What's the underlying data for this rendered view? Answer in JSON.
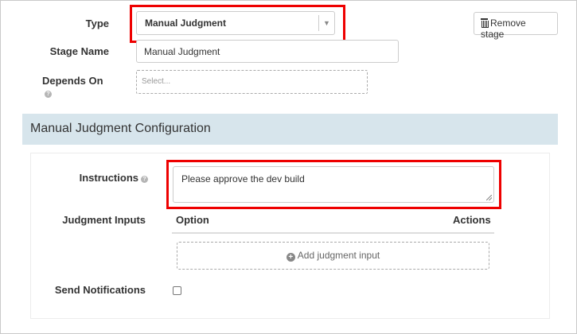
{
  "form": {
    "type_label": "Type",
    "type_value": "Manual Judgment",
    "stage_name_label": "Stage Name",
    "stage_name_value": "Manual Judgment",
    "depends_on_label": "Depends On",
    "depends_on_placeholder": "Select...",
    "remove_stage_label": "Remove stage"
  },
  "config": {
    "header": "Manual Judgment Configuration",
    "instructions_label": "Instructions",
    "instructions_value": "Please approve the dev build",
    "judgment_inputs_label": "Judgment Inputs",
    "columns": [
      "Option",
      "Actions"
    ],
    "add_input_label": "Add judgment input",
    "send_notifications_label": "Send Notifications",
    "send_notifications_checked": false
  },
  "colors": {
    "highlight": "#e00000",
    "section_header_bg": "#d7e5ec"
  }
}
